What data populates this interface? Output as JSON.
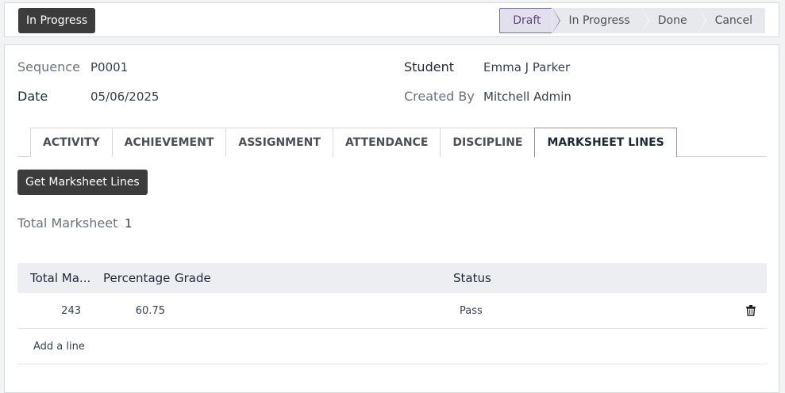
{
  "header": {
    "action_button": "In Progress",
    "stages": [
      "Draft",
      "In Progress",
      "Done",
      "Cancel"
    ],
    "active_stage": "Draft"
  },
  "form": {
    "sequence_label": "Sequence",
    "sequence_value": "P0001",
    "student_label": "Student",
    "student_value": "Emma J Parker",
    "date_label": "Date",
    "date_value": "05/06/2025",
    "created_by_label": "Created By",
    "created_by_value": "Mitchell Admin"
  },
  "tabs": [
    "ACTIVITY",
    "ACHIEVEMENT",
    "ASSIGNMENT",
    "ATTENDANCE",
    "DISCIPLINE",
    "MARKSHEET LINES"
  ],
  "active_tab": "MARKSHEET LINES",
  "marksheet": {
    "get_lines_button": "Get Marksheet Lines",
    "total_label": "Total Marksheet",
    "total_value": "1",
    "columns": {
      "total": "Total Ma...",
      "percentage": "Percentage",
      "grade": "Grade",
      "status": "Status"
    },
    "rows": [
      {
        "total": "243",
        "percentage": "60.75",
        "grade": "",
        "status": "Pass"
      }
    ],
    "add_line": "Add a line"
  },
  "icons": {
    "delete": "trash-icon"
  },
  "colors": {
    "primary_button": "#3c3c3c",
    "active_stage_border": "#7a6a99"
  }
}
